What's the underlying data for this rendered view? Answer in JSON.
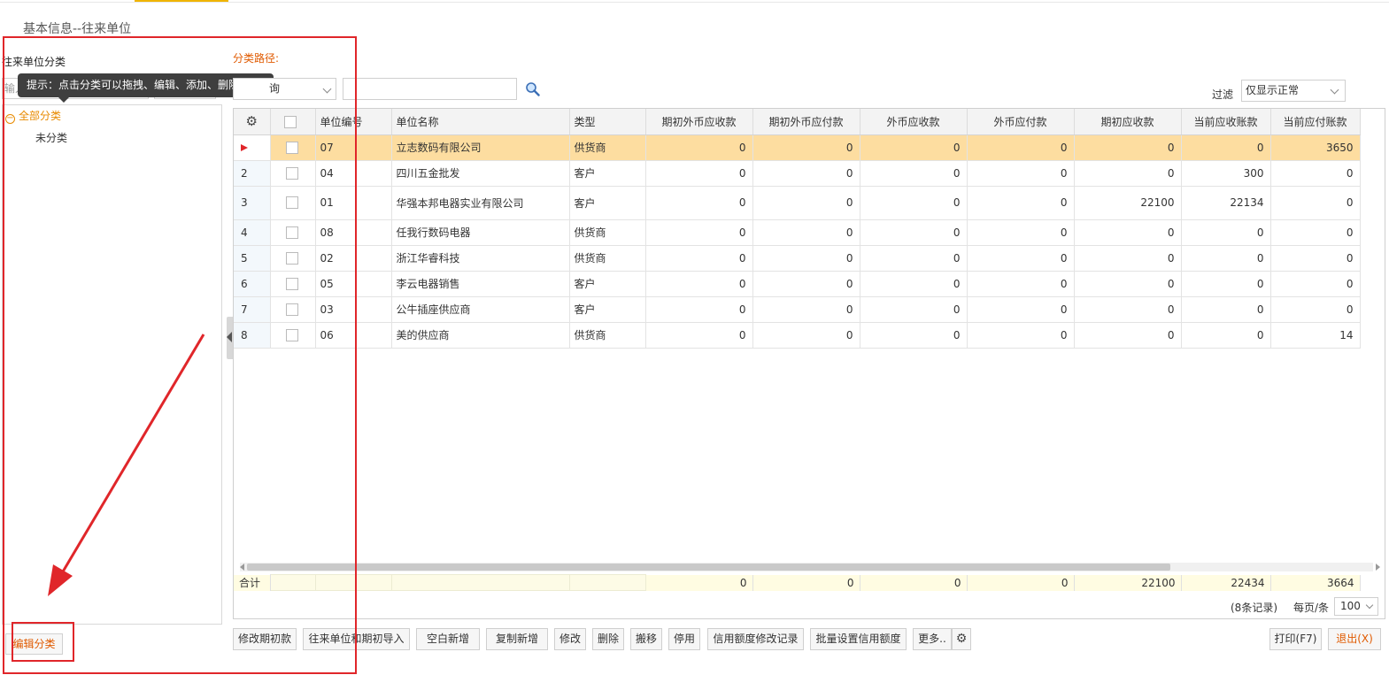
{
  "page_title": "基本信息--往来单位",
  "left_panel": {
    "label": "往来单位分类",
    "input_placeholder": "输入",
    "tooltip": "提示：点击分类可以拖拽、编辑、添加、删除分类!",
    "tree": {
      "all": "全部分类",
      "uncategorized": "未分类"
    },
    "edit_button": "编辑分类"
  },
  "toolbar_top": {
    "category_path_label": "分类路径:",
    "select_text": "询",
    "filter_label": "过滤",
    "filter_value": "仅显示正常"
  },
  "grid": {
    "headers": [
      "单位编号",
      "单位名称",
      "类型",
      "期初外币应收款",
      "期初外币应付款",
      "外币应收款",
      "外币应付款",
      "期初应收款",
      "当前应收账款",
      "当前应付账款"
    ],
    "rows": [
      [
        "",
        "07",
        "立志数码有限公司",
        "供货商",
        "0",
        "0",
        "0",
        "0",
        "0",
        "0",
        "3650"
      ],
      [
        "2",
        "04",
        "四川五金批发",
        "客户",
        "0",
        "0",
        "0",
        "0",
        "0",
        "300",
        "0"
      ],
      [
        "3",
        "01",
        "华强本邦电器实业有限公司",
        "客户",
        "0",
        "0",
        "0",
        "0",
        "22100",
        "22134",
        "0"
      ],
      [
        "4",
        "08",
        "任我行数码电器",
        "供货商",
        "0",
        "0",
        "0",
        "0",
        "0",
        "0",
        "0"
      ],
      [
        "5",
        "02",
        "浙江华睿科技",
        "供货商",
        "0",
        "0",
        "0",
        "0",
        "0",
        "0",
        "0"
      ],
      [
        "6",
        "05",
        "李云电器销售",
        "客户",
        "0",
        "0",
        "0",
        "0",
        "0",
        "0",
        "0"
      ],
      [
        "7",
        "03",
        "公牛插座供应商",
        "客户",
        "0",
        "0",
        "0",
        "0",
        "0",
        "0",
        "0"
      ],
      [
        "8",
        "06",
        "美的供应商",
        "供货商",
        "0",
        "0",
        "0",
        "0",
        "0",
        "0",
        "14"
      ]
    ],
    "totals": {
      "label": "合计",
      "values": [
        "0",
        "0",
        "0",
        "0",
        "22100",
        "22434",
        "3664"
      ]
    },
    "records_text": "(8条记录)",
    "per_page_label": "每页/条",
    "per_page_value": "100"
  },
  "buttons": {
    "modify_opening": "修改期初款",
    "import_opening": "往来单位和期初导入",
    "new_blank": "空白新增",
    "copy_new": "复制新增",
    "modify": "修改",
    "delete": "删除",
    "move": "搬移",
    "disable": "停用",
    "credit_log": "信用额度修改记录",
    "batch_credit": "批量设置信用额度",
    "more": "更多..",
    "print": "打印(F7)",
    "exit": "退出(X)"
  },
  "colors": {
    "accent": "#f0b400",
    "annotation_red": "#e0262a",
    "selected_row": "#fddda0",
    "link_orange": "#e05a00"
  }
}
